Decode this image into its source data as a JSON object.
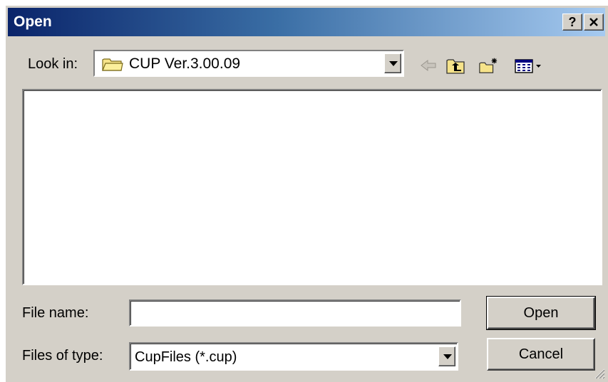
{
  "dialog": {
    "title": "Open",
    "help_glyph": "?",
    "close_glyph": "X"
  },
  "lookin": {
    "label": "Look in:",
    "value": "CUP Ver.3.00.09",
    "icon": "folder-icon"
  },
  "toolbar": {
    "icons": [
      "back-arrow-icon",
      "up-one-level-icon",
      "create-new-folder-icon",
      "view-menu-icon"
    ]
  },
  "filename": {
    "label": "File name:",
    "value": ""
  },
  "filetype": {
    "label": "Files of type:",
    "value": "CupFiles (*.cup)"
  },
  "buttons": {
    "open": "Open",
    "cancel": "Cancel"
  },
  "colors": {
    "title_start": "#0a246a",
    "title_end": "#a6caf0",
    "face": "#d4d0c8"
  }
}
